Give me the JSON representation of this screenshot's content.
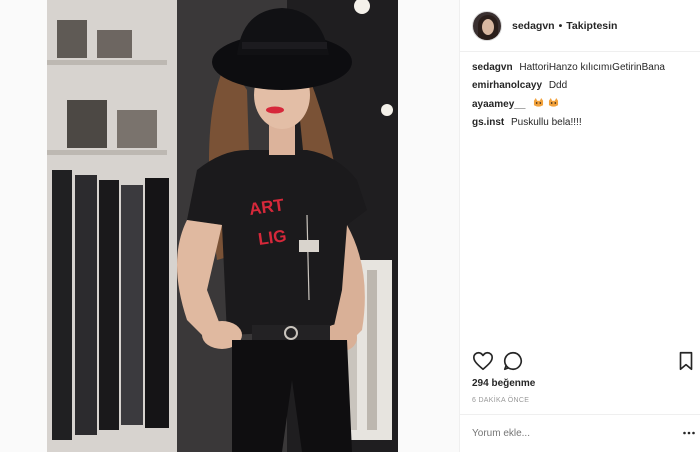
{
  "header": {
    "username": "sedagvn",
    "separator": "•",
    "follow_status": "Takiptesin"
  },
  "comments": [
    {
      "user": "sedagvn",
      "text": "HattoriHanzo kılıcımıGetirinBana"
    },
    {
      "user": "emirhanolcayy",
      "text": "Ddd"
    },
    {
      "user": "ayaamey__",
      "text": ""
    },
    {
      "user": "gs.inst",
      "text": "Puskullu bela!!!!"
    }
  ],
  "actions": {
    "like_icon": "heart-icon",
    "comment_icon": "comment-icon",
    "save_icon": "bookmark-icon"
  },
  "likes_text": "294 beğenme",
  "time_text": "6 DAKİKA ÖNCE",
  "comment_input": {
    "placeholder": "Yorum ekle..."
  },
  "more_icon": "ellipsis-icon",
  "photo": {
    "shirt_text_1": "LIG",
    "shirt_text_2": "ART"
  },
  "colors": {
    "accent_red": "#d6283a",
    "text": "#262626",
    "muted": "#999999",
    "border": "#efefef"
  }
}
